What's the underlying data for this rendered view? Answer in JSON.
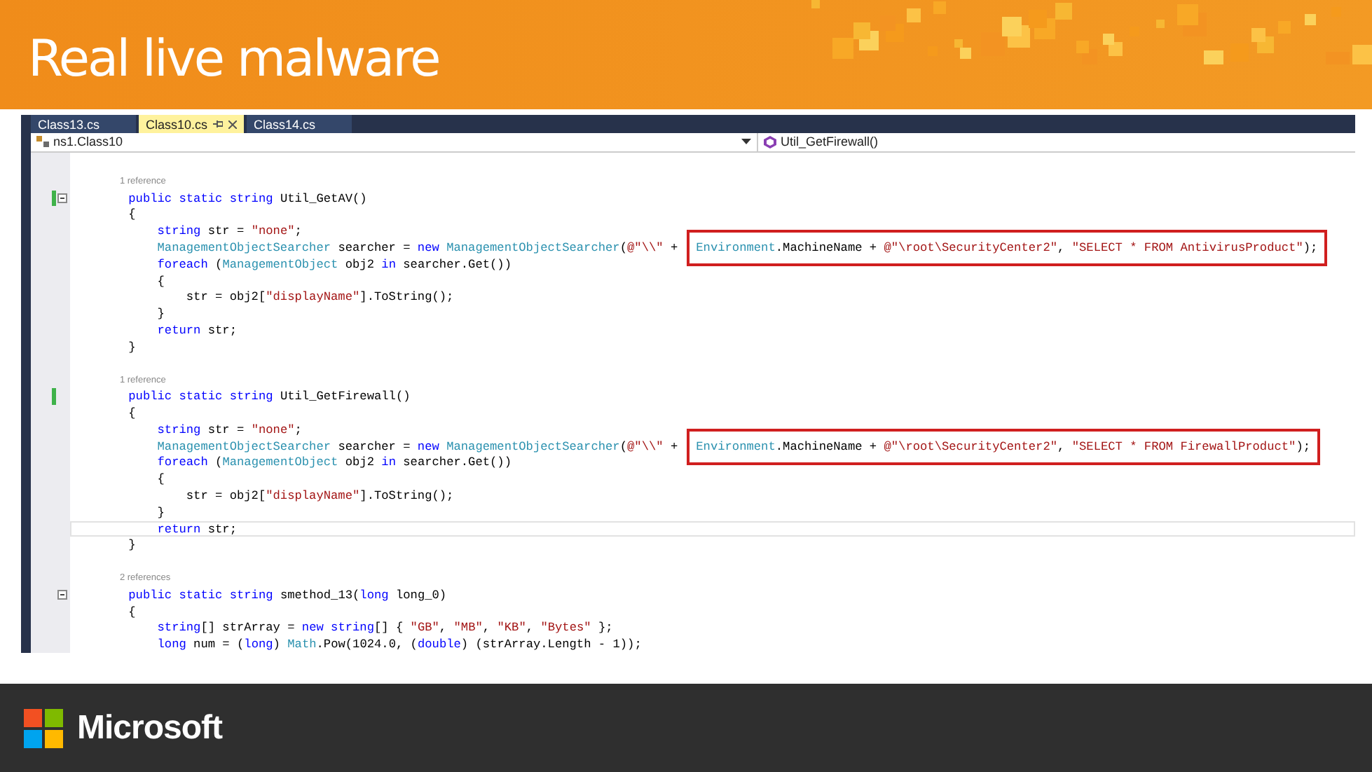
{
  "slide": {
    "title": "Real live malware",
    "brand": "Microsoft"
  },
  "editor": {
    "tabs": [
      {
        "label": "Class13.cs",
        "selected": false
      },
      {
        "label": "Class10.cs",
        "selected": true
      },
      {
        "label": "Class14.cs",
        "selected": false
      }
    ],
    "nav": {
      "scope": "ns1.Class10",
      "member": "Util_GetFirewall()"
    },
    "lines": [
      {
        "kind": "lens",
        "text": "1 reference"
      },
      {
        "kind": "code",
        "changed": true,
        "fold": true,
        "current": false,
        "tokens": [
          {
            "kind": "keyword",
            "s": "public static string"
          },
          {
            "kind": "plain",
            "s": " Util_GetAV()"
          }
        ]
      },
      {
        "kind": "code",
        "changed": false,
        "fold": false,
        "current": false,
        "tokens": [
          {
            "kind": "plain",
            "s": "{"
          }
        ],
        "children": [
          {
            "kind": "code",
            "changed": false,
            "fold": false,
            "current": false,
            "tokens": [
              {
                "kind": "keyword",
                "s": "string"
              },
              {
                "kind": "plain",
                "s": " str = "
              },
              {
                "kind": "string",
                "s": "\"none\""
              },
              {
                "kind": "plain",
                "s": ";"
              }
            ]
          },
          {
            "kind": "code",
            "changed": false,
            "fold": false,
            "current": false,
            "tokens": [
              {
                "kind": "type",
                "s": "ManagementObjectSearcher"
              },
              {
                "kind": "plain",
                "s": " searcher = "
              },
              {
                "kind": "keyword",
                "s": "new "
              },
              {
                "kind": "type",
                "s": "ManagementObjectSearcher"
              },
              {
                "kind": "plain",
                "s": "("
              },
              {
                "kind": "string",
                "s": "@\"\\\\\""
              },
              {
                "kind": "plain",
                "s": " +"
              }
            ],
            "boxed": [
              {
                "kind": "type",
                "s": "Environment"
              },
              {
                "kind": "plain",
                "s": ".MachineName + "
              },
              {
                "kind": "string",
                "s": "@\"\\root\\SecurityCenter2\""
              },
              {
                "kind": "plain",
                "s": ", "
              },
              {
                "kind": "string",
                "s": "\"SELECT * FROM AntivirusProduct\""
              },
              {
                "kind": "plain",
                "s": ");"
              }
            ]
          },
          {
            "kind": "code",
            "changed": false,
            "fold": false,
            "current": false,
            "tokens": [
              {
                "kind": "keyword",
                "s": "foreach"
              },
              {
                "kind": "plain",
                "s": " ("
              },
              {
                "kind": "type",
                "s": "ManagementObject"
              },
              {
                "kind": "plain",
                "s": " obj2 "
              },
              {
                "kind": "keyword",
                "s": "in"
              },
              {
                "kind": "plain",
                "s": " searcher.Get())"
              }
            ]
          },
          {
            "kind": "code",
            "changed": false,
            "fold": false,
            "current": false,
            "tokens": [
              {
                "kind": "plain",
                "s": "{"
              }
            ],
            "children": [
              {
                "kind": "code",
                "changed": false,
                "fold": false,
                "current": false,
                "tokens": [
                  {
                    "kind": "plain",
                    "s": "str = obj2["
                  },
                  {
                    "kind": "string",
                    "s": "\"displayName\""
                  },
                  {
                    "kind": "plain",
                    "s": "].ToString();"
                  }
                ]
              }
            ]
          },
          {
            "kind": "code",
            "changed": false,
            "fold": false,
            "current": false,
            "tokens": [
              {
                "kind": "plain",
                "s": "}"
              }
            ]
          },
          {
            "kind": "code",
            "changed": false,
            "fold": false,
            "current": false,
            "tokens": [
              {
                "kind": "keyword",
                "s": "return"
              },
              {
                "kind": "plain",
                "s": " str;"
              }
            ]
          }
        ]
      },
      {
        "kind": "code",
        "changed": false,
        "fold": false,
        "current": false,
        "tokens": [
          {
            "kind": "plain",
            "s": "}"
          }
        ]
      },
      {
        "kind": "blank"
      },
      {
        "kind": "lens",
        "text": "1 reference"
      },
      {
        "kind": "code",
        "changed": true,
        "fold": false,
        "current": false,
        "tokens": [
          {
            "kind": "keyword",
            "s": "public static string"
          },
          {
            "kind": "plain",
            "s": " Util_GetFirewall()"
          }
        ]
      },
      {
        "kind": "code",
        "changed": false,
        "fold": false,
        "current": false,
        "tokens": [
          {
            "kind": "plain",
            "s": "{"
          }
        ],
        "children": [
          {
            "kind": "code",
            "changed": false,
            "fold": false,
            "current": false,
            "tokens": [
              {
                "kind": "keyword",
                "s": "string"
              },
              {
                "kind": "plain",
                "s": " str = "
              },
              {
                "kind": "string",
                "s": "\"none\""
              },
              {
                "kind": "plain",
                "s": ";"
              }
            ]
          },
          {
            "kind": "code",
            "changed": false,
            "fold": false,
            "current": false,
            "tokens": [
              {
                "kind": "type",
                "s": "ManagementObjectSearcher"
              },
              {
                "kind": "plain",
                "s": " searcher = "
              },
              {
                "kind": "keyword",
                "s": "new "
              },
              {
                "kind": "type",
                "s": "ManagementObjectSearcher"
              },
              {
                "kind": "plain",
                "s": "("
              },
              {
                "kind": "string",
                "s": "@\"\\\\\""
              },
              {
                "kind": "plain",
                "s": " +"
              }
            ],
            "boxed": [
              {
                "kind": "type",
                "s": "Environment"
              },
              {
                "kind": "plain",
                "s": ".MachineName + "
              },
              {
                "kind": "string",
                "s": "@\"\\root\\SecurityCenter2\""
              },
              {
                "kind": "plain",
                "s": ", "
              },
              {
                "kind": "string",
                "s": "\"SELECT * FROM FirewallProduct\""
              },
              {
                "kind": "plain",
                "s": ");"
              }
            ]
          },
          {
            "kind": "code",
            "changed": false,
            "fold": false,
            "current": false,
            "tokens": [
              {
                "kind": "keyword",
                "s": "foreach"
              },
              {
                "kind": "plain",
                "s": " ("
              },
              {
                "kind": "type",
                "s": "ManagementObject"
              },
              {
                "kind": "plain",
                "s": " obj2 "
              },
              {
                "kind": "keyword",
                "s": "in"
              },
              {
                "kind": "plain",
                "s": " searcher.Get())"
              }
            ]
          },
          {
            "kind": "code",
            "changed": false,
            "fold": false,
            "current": false,
            "tokens": [
              {
                "kind": "plain",
                "s": "{"
              }
            ],
            "children": [
              {
                "kind": "code",
                "changed": false,
                "fold": false,
                "current": false,
                "tokens": [
                  {
                    "kind": "plain",
                    "s": "str = obj2["
                  },
                  {
                    "kind": "string",
                    "s": "\"displayName\""
                  },
                  {
                    "kind": "plain",
                    "s": "].ToString();"
                  }
                ]
              }
            ]
          },
          {
            "kind": "code",
            "changed": false,
            "fold": false,
            "current": false,
            "tokens": [
              {
                "kind": "plain",
                "s": "}"
              }
            ]
          },
          {
            "kind": "code",
            "changed": false,
            "fold": false,
            "current": true,
            "tokens": [
              {
                "kind": "keyword",
                "s": "return"
              },
              {
                "kind": "plain",
                "s": " str;"
              }
            ]
          }
        ]
      },
      {
        "kind": "code",
        "changed": false,
        "fold": false,
        "current": false,
        "tokens": [
          {
            "kind": "plain",
            "s": "}"
          }
        ]
      },
      {
        "kind": "blank"
      },
      {
        "kind": "lens",
        "text": "2 references"
      },
      {
        "kind": "code",
        "changed": false,
        "fold": true,
        "current": false,
        "tokens": [
          {
            "kind": "keyword",
            "s": "public static string"
          },
          {
            "kind": "plain",
            "s": " smethod_13("
          },
          {
            "kind": "keyword",
            "s": "long"
          },
          {
            "kind": "plain",
            "s": " long_0)"
          }
        ]
      },
      {
        "kind": "code",
        "changed": false,
        "fold": false,
        "current": false,
        "tokens": [
          {
            "kind": "plain",
            "s": "{"
          }
        ],
        "children": [
          {
            "kind": "code",
            "changed": false,
            "fold": false,
            "current": false,
            "tokens": [
              {
                "kind": "keyword",
                "s": "string"
              },
              {
                "kind": "plain",
                "s": "[] strArray = "
              },
              {
                "kind": "keyword",
                "s": "new string"
              },
              {
                "kind": "plain",
                "s": "[] { "
              },
              {
                "kind": "string",
                "s": "\"GB\""
              },
              {
                "kind": "plain",
                "s": ", "
              },
              {
                "kind": "string",
                "s": "\"MB\""
              },
              {
                "kind": "plain",
                "s": ", "
              },
              {
                "kind": "string",
                "s": "\"KB\""
              },
              {
                "kind": "plain",
                "s": ", "
              },
              {
                "kind": "string",
                "s": "\"Bytes\""
              },
              {
                "kind": "plain",
                "s": " };"
              }
            ]
          },
          {
            "kind": "code",
            "changed": false,
            "fold": false,
            "current": false,
            "tokens": [
              {
                "kind": "keyword",
                "s": "long"
              },
              {
                "kind": "plain",
                "s": " num = ("
              },
              {
                "kind": "keyword",
                "s": "long"
              },
              {
                "kind": "plain",
                "s": ") "
              },
              {
                "kind": "type",
                "s": "Math"
              },
              {
                "kind": "plain",
                "s": ".Pow(1024.0, ("
              },
              {
                "kind": "keyword",
                "s": "double"
              },
              {
                "kind": "plain",
                "s": ") (strArray.Length - 1));"
              }
            ]
          }
        ]
      }
    ]
  }
}
